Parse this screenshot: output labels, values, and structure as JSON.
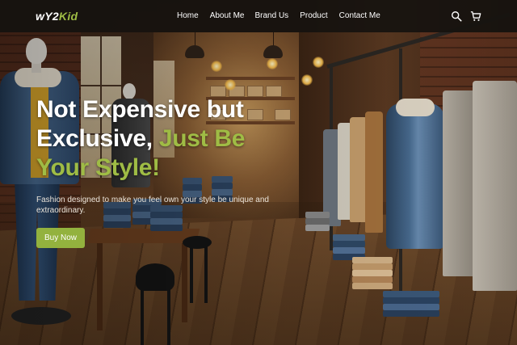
{
  "brand": {
    "logo_main": "wY2",
    "logo_accent": "Kid"
  },
  "nav": {
    "links": [
      "Home",
      "About Me",
      "Brand Us",
      "Product",
      "Contact Me"
    ]
  },
  "icons": {
    "search": "search-icon",
    "cart": "cart-icon"
  },
  "hero": {
    "title_line1": "Not Expensive but",
    "title_line2_a": "Exclusive,",
    "title_line2_b": "Just Be",
    "title_line3": "Your Style!",
    "subtitle": "Fashion designed to make you feel own your style be unique and extraordinary.",
    "cta_label": "Buy Now"
  },
  "colors": {
    "accent": "#9fbc45",
    "cta": "#93b23e",
    "nav_bg": "#16120f",
    "text": "#ffffff"
  }
}
